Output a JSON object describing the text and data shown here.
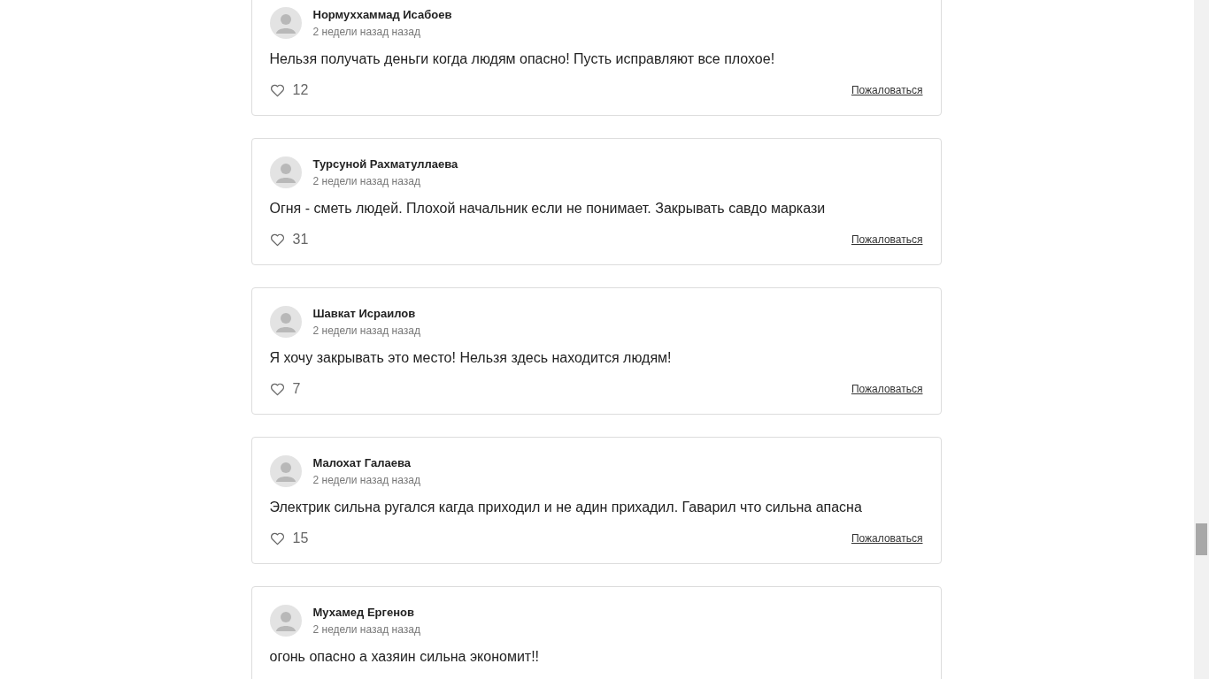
{
  "comments": [
    {
      "author": "Нормуххаммад Исабоев",
      "time": "2 недели назад назад",
      "text": "Нельзя получать деньги когда людям опасно! Пусть исправляют все плохое!",
      "likes": "12",
      "report": "Пожаловаться"
    },
    {
      "author": "Турсуной Рахматуллаева",
      "time": "2 недели назад назад",
      "text": "Огня - сметь людей. Плохой начальник если не понимает. Закрывать савдо маркази",
      "likes": "31",
      "report": "Пожаловаться"
    },
    {
      "author": "Шавкат Исраилов",
      "time": "2 недели назад назад",
      "text": "Я хочу закрывать это место! Нельзя здесь находится людям!",
      "likes": "7",
      "report": "Пожаловаться"
    },
    {
      "author": "Малохат Галаева",
      "time": "2 недели назад назад",
      "text": "Электрик сильна ругался кагда приходил и не адин прихадил. Гаварил что сильна апасна",
      "likes": "15",
      "report": "Пожаловаться"
    },
    {
      "author": "Мухамед Ергенов",
      "time": "2 недели назад назад",
      "text": "огонь опасно а хазяин сильна экономит!!"
    }
  ]
}
